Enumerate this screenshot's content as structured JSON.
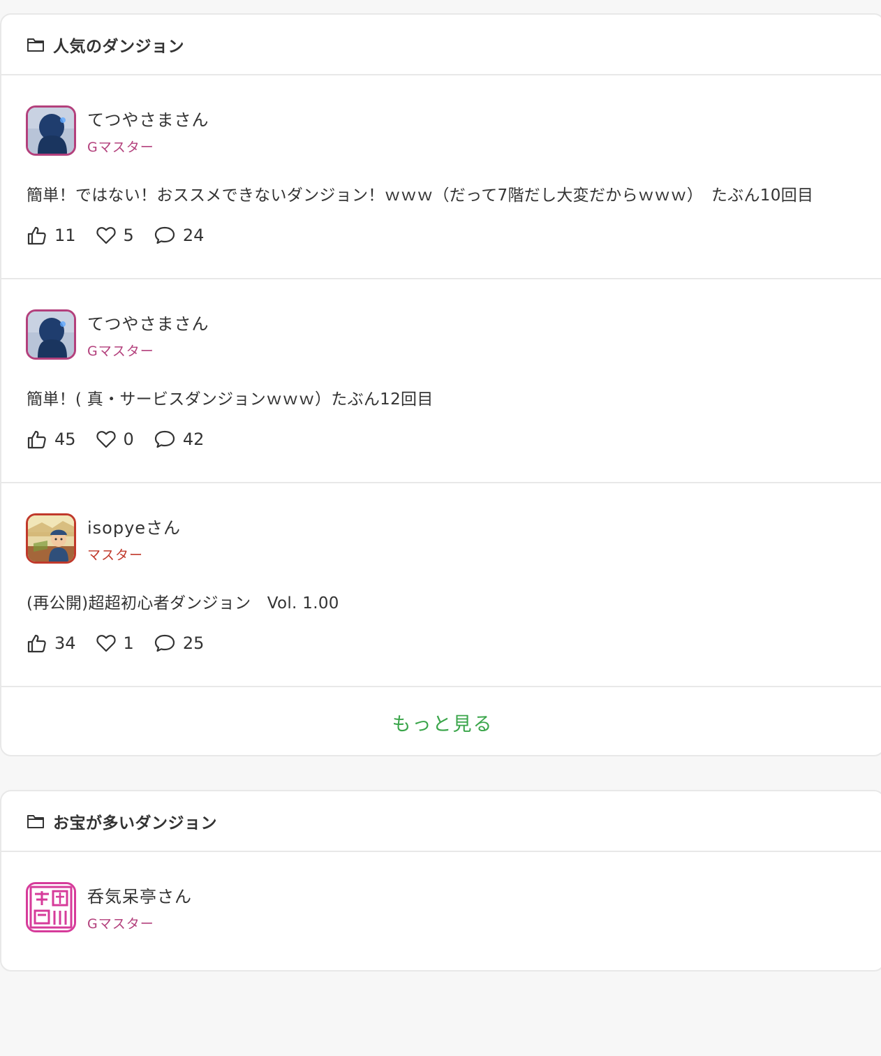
{
  "section1": {
    "title": "人気のダンジョン",
    "posts": [
      {
        "username": "てつやさまさん",
        "rank": "Gマスター",
        "text": "簡単！ではない！おススメできないダンジョン！ｗｗｗ（だって7階だし大変だからｗｗｗ）　たぶん10回目",
        "likes": "11",
        "favorites": "5",
        "comments": "24"
      },
      {
        "username": "てつやさまさん",
        "rank": "Gマスター",
        "text": "簡単！( 真・サービスダンジョンｗｗｗ）たぶん12回目",
        "likes": "45",
        "favorites": "0",
        "comments": "42"
      },
      {
        "username": "isopyeさん",
        "rank": "マスター",
        "text": "(再公開)超超初心者ダンジョン　Vol. 1.00",
        "likes": "34",
        "favorites": "1",
        "comments": "25"
      }
    ],
    "more_label": "もっと見る"
  },
  "section2": {
    "title": "お宝が多いダンジョン",
    "posts": [
      {
        "username": "呑気呆亭さん",
        "rank": "Gマスター"
      }
    ]
  },
  "colors": {
    "gmaster": "#b3407c",
    "master": "#c0392b",
    "more_link": "#3aa54a"
  },
  "icons": [
    "folder-icon",
    "thumbs-up-icon",
    "heart-icon",
    "comment-icon"
  ]
}
